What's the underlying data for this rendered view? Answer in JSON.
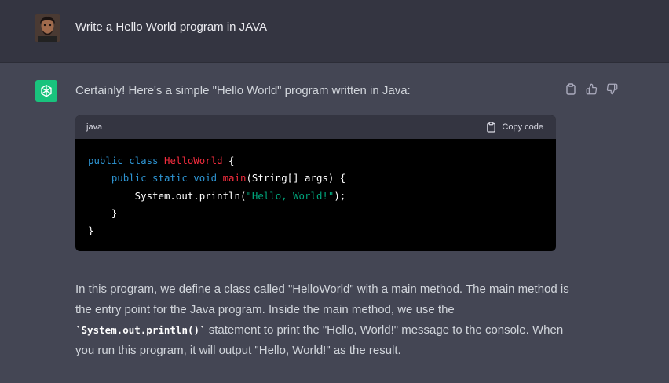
{
  "user": {
    "avatar_alt": "user-avatar",
    "message": "Write a Hello World program in JAVA"
  },
  "assistant": {
    "intro": "Certainly! Here's a simple \"Hello World\" program written in Java:",
    "code_block": {
      "language": "java",
      "copy_label": "Copy code",
      "lines": [
        {
          "parts": [
            {
              "t": "public class ",
              "c": "kw"
            },
            {
              "t": "HelloWorld",
              "c": "cls"
            },
            {
              "t": " {",
              "c": ""
            }
          ]
        },
        {
          "parts": [
            {
              "t": "    ",
              "c": ""
            },
            {
              "t": "public static void ",
              "c": "kw"
            },
            {
              "t": "main",
              "c": "cls"
            },
            {
              "t": "(String[] args) {",
              "c": ""
            }
          ]
        },
        {
          "parts": [
            {
              "t": "        System.out.println(",
              "c": ""
            },
            {
              "t": "\"Hello, World!\"",
              "c": "str"
            },
            {
              "t": ");",
              "c": ""
            }
          ]
        },
        {
          "parts": [
            {
              "t": "    }",
              "c": ""
            }
          ]
        },
        {
          "parts": [
            {
              "t": "}",
              "c": ""
            }
          ]
        }
      ]
    },
    "explanation": {
      "part1": "In this program, we define a class called \"HelloWorld\" with a main method. The main method is the entry point for the Java program. Inside the main method, we use the ",
      "inline_code": "`System.out.println()`",
      "part2": " statement to print the \"Hello, World!\" message to the console. When you run this program, it will output \"Hello, World!\" as the result."
    },
    "actions": [
      "clipboard-icon",
      "thumbs-up-icon",
      "thumbs-down-icon"
    ]
  },
  "colors": {
    "user_bg": "#343541",
    "assistant_bg": "#444654",
    "bot_avatar": "#19c37d",
    "keyword": "#2e95d3",
    "class_name": "#f22c3d",
    "string": "#00a67d"
  }
}
